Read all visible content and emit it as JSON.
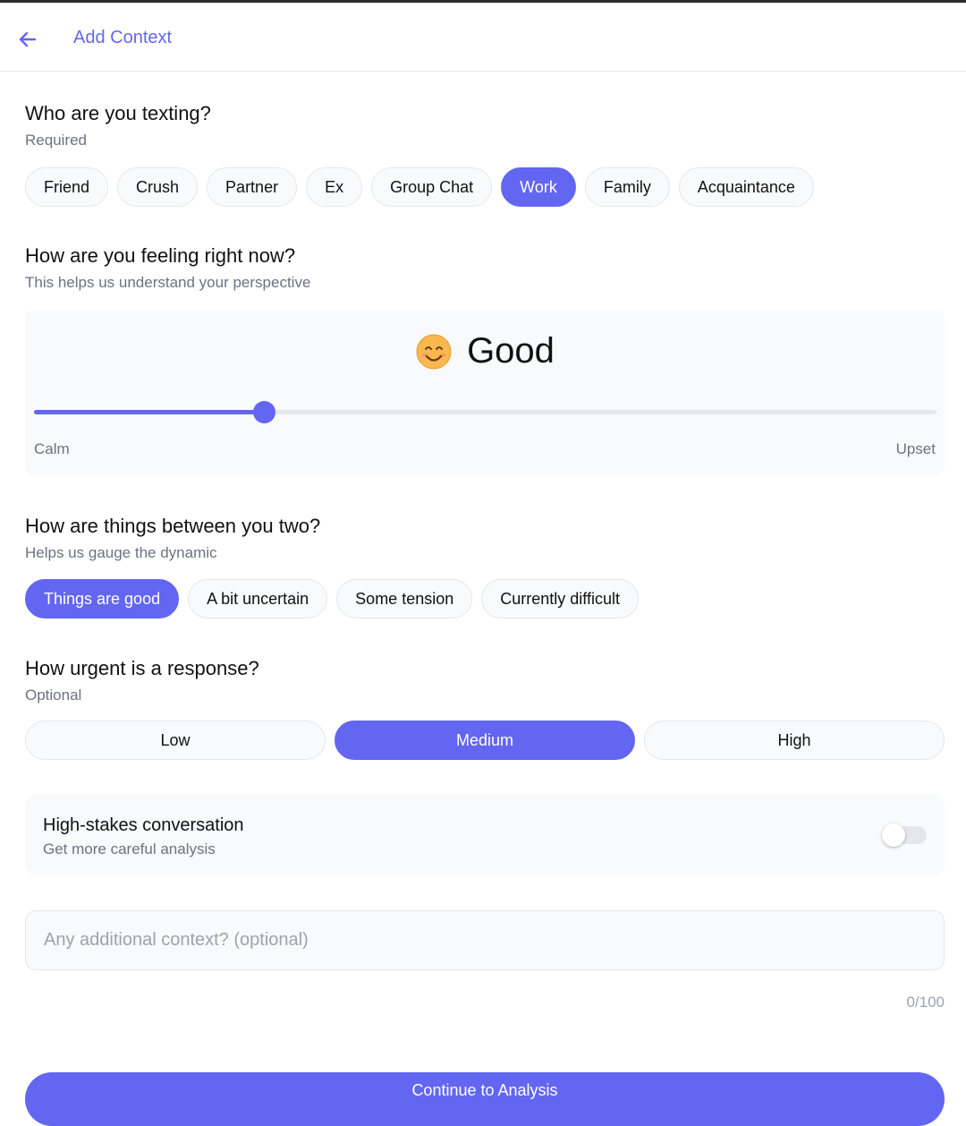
{
  "header": {
    "title": "Add Context",
    "back_icon": "arrow-left-icon",
    "accent": "#6366f1"
  },
  "recipient": {
    "title": "Who are you texting?",
    "subtitle": "Required",
    "options": [
      "Friend",
      "Crush",
      "Partner",
      "Ex",
      "Group Chat",
      "Work",
      "Family",
      "Acquaintance"
    ],
    "selected": "Work"
  },
  "feeling": {
    "title": "How are you feeling right now?",
    "subtitle": "This helps us understand your perspective",
    "emoji": "smiling-face-icon",
    "label": "Good",
    "value": 0.255,
    "min_label": "Calm",
    "max_label": "Upset"
  },
  "relationship": {
    "title": "How are things between you two?",
    "subtitle": "Helps us gauge the dynamic",
    "options": [
      "Things are good",
      "A bit uncertain",
      "Some tension",
      "Currently difficult"
    ],
    "selected": "Things are good"
  },
  "urgency": {
    "title": "How urgent is a response?",
    "subtitle": "Optional",
    "options": [
      "Low",
      "Medium",
      "High"
    ],
    "selected": "Medium"
  },
  "high_stakes": {
    "title": "High-stakes conversation",
    "subtitle": "Get more careful analysis",
    "enabled": false
  },
  "context": {
    "placeholder": "Any additional context? (optional)",
    "value": "",
    "counter": "0/100"
  },
  "cta": {
    "label": "Continue to Analysis"
  }
}
